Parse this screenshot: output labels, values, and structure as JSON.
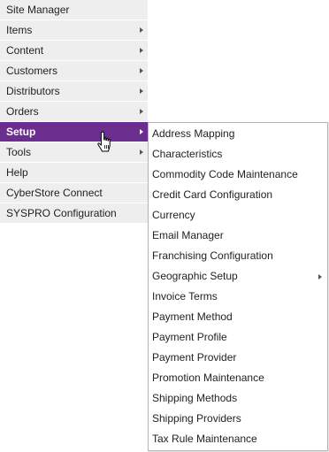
{
  "main_menu": {
    "items": [
      {
        "label": "Site Manager",
        "has_submenu": false
      },
      {
        "label": "Items",
        "has_submenu": true
      },
      {
        "label": "Content",
        "has_submenu": true
      },
      {
        "label": "Customers",
        "has_submenu": true
      },
      {
        "label": "Distributors",
        "has_submenu": true
      },
      {
        "label": "Orders",
        "has_submenu": true
      },
      {
        "label": "Setup",
        "has_submenu": true,
        "active": true
      },
      {
        "label": "Tools",
        "has_submenu": true
      },
      {
        "label": "Help",
        "has_submenu": false
      },
      {
        "label": "CyberStore Connect",
        "has_submenu": false
      },
      {
        "label": "SYSPRO Configuration",
        "has_submenu": false
      }
    ]
  },
  "setup_submenu": {
    "items": [
      {
        "label": "Address Mapping"
      },
      {
        "label": "Characteristics"
      },
      {
        "label": "Commodity Code Maintenance"
      },
      {
        "label": "Credit Card Configuration"
      },
      {
        "label": "Currency"
      },
      {
        "label": "Email Manager"
      },
      {
        "label": "Franchising Configuration"
      },
      {
        "label": "Geographic Setup",
        "has_submenu": true
      },
      {
        "label": "Invoice Terms"
      },
      {
        "label": "Payment Method"
      },
      {
        "label": "Payment Profile"
      },
      {
        "label": "Payment Provider"
      },
      {
        "label": "Promotion Maintenance"
      },
      {
        "label": "Shipping Methods"
      },
      {
        "label": "Shipping Providers"
      },
      {
        "label": "Tax Rule Maintenance"
      }
    ]
  },
  "cursor": {
    "icon": "hand-pointer-icon"
  },
  "colors": {
    "active_bg": "#6a2e8e",
    "menu_bg": "#eeeeee",
    "submenu_border": "#b5b5b5"
  }
}
